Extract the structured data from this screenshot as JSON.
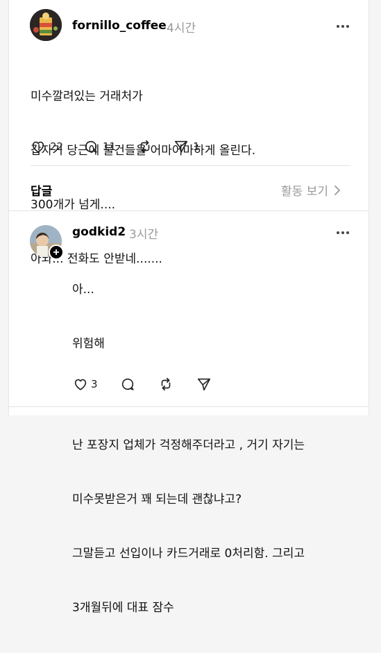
{
  "post": {
    "username": "fornillo_coffee",
    "time": "4시간",
    "lines": [
      "미수깔려있는 거래처가",
      "갑자기 당근에 물건들을 어마어마하게 올린다.",
      "300개가 넘게....",
      "아놔... 전화도 안받네......."
    ],
    "likes": "22",
    "comments": "11",
    "shares": "1"
  },
  "replies_header": {
    "title": "답글",
    "activity_label": "활동 보기"
  },
  "reply": {
    "username": "godkid2",
    "time": "3시간",
    "lines": [
      "아...",
      "위험해",
      "",
      "난 포장지 업체가 걱정해주더라고 , 거기 자기는",
      "미수못받은거 꽤 되는데 괜찮냐고?",
      "그말듣고 선입이나 카드거래로 0처리함. 그리고",
      "3개월뒤에 대표 잠수"
    ],
    "likes": "3"
  }
}
